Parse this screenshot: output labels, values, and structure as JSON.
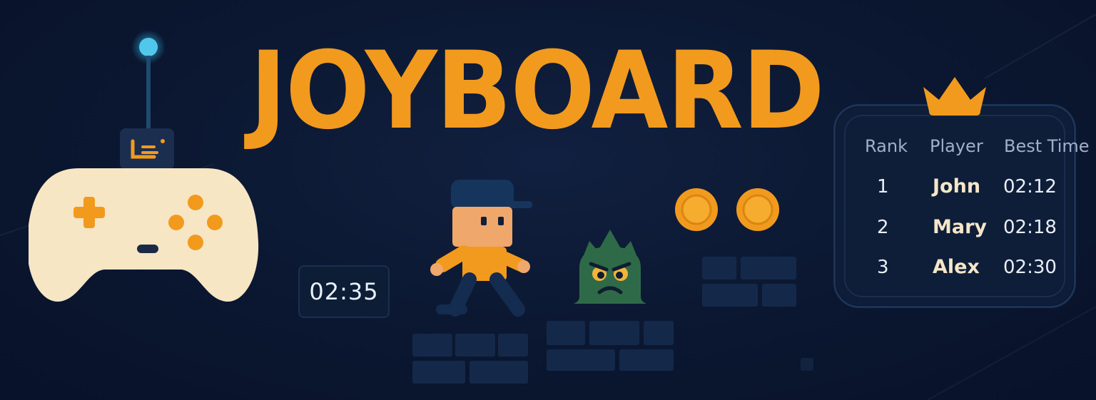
{
  "title": "JOYBOARD",
  "timer": {
    "value": "02:35"
  },
  "leaderboard": {
    "columns": [
      "Rank",
      "Player",
      "Best Time"
    ],
    "rows": [
      {
        "rank": "1",
        "player": "John",
        "time": "02:12"
      },
      {
        "rank": "2",
        "player": "Mary",
        "time": "02:18"
      },
      {
        "rank": "3",
        "player": "Alex",
        "time": "02:30"
      }
    ]
  },
  "sprites": {
    "controller": "game-controller-icon",
    "player": "runner-character",
    "enemy": "spiky-monster",
    "coins": 2,
    "crown": "crown-icon"
  },
  "colors": {
    "background": "#0b1730",
    "accent_orange": "#f29a1e",
    "controller_body": "#f7e6c4",
    "antenna_glow": "#52c7ec",
    "enemy_green": "#2f6a48",
    "brick": "#14294a",
    "board_border": "#1c3356"
  }
}
